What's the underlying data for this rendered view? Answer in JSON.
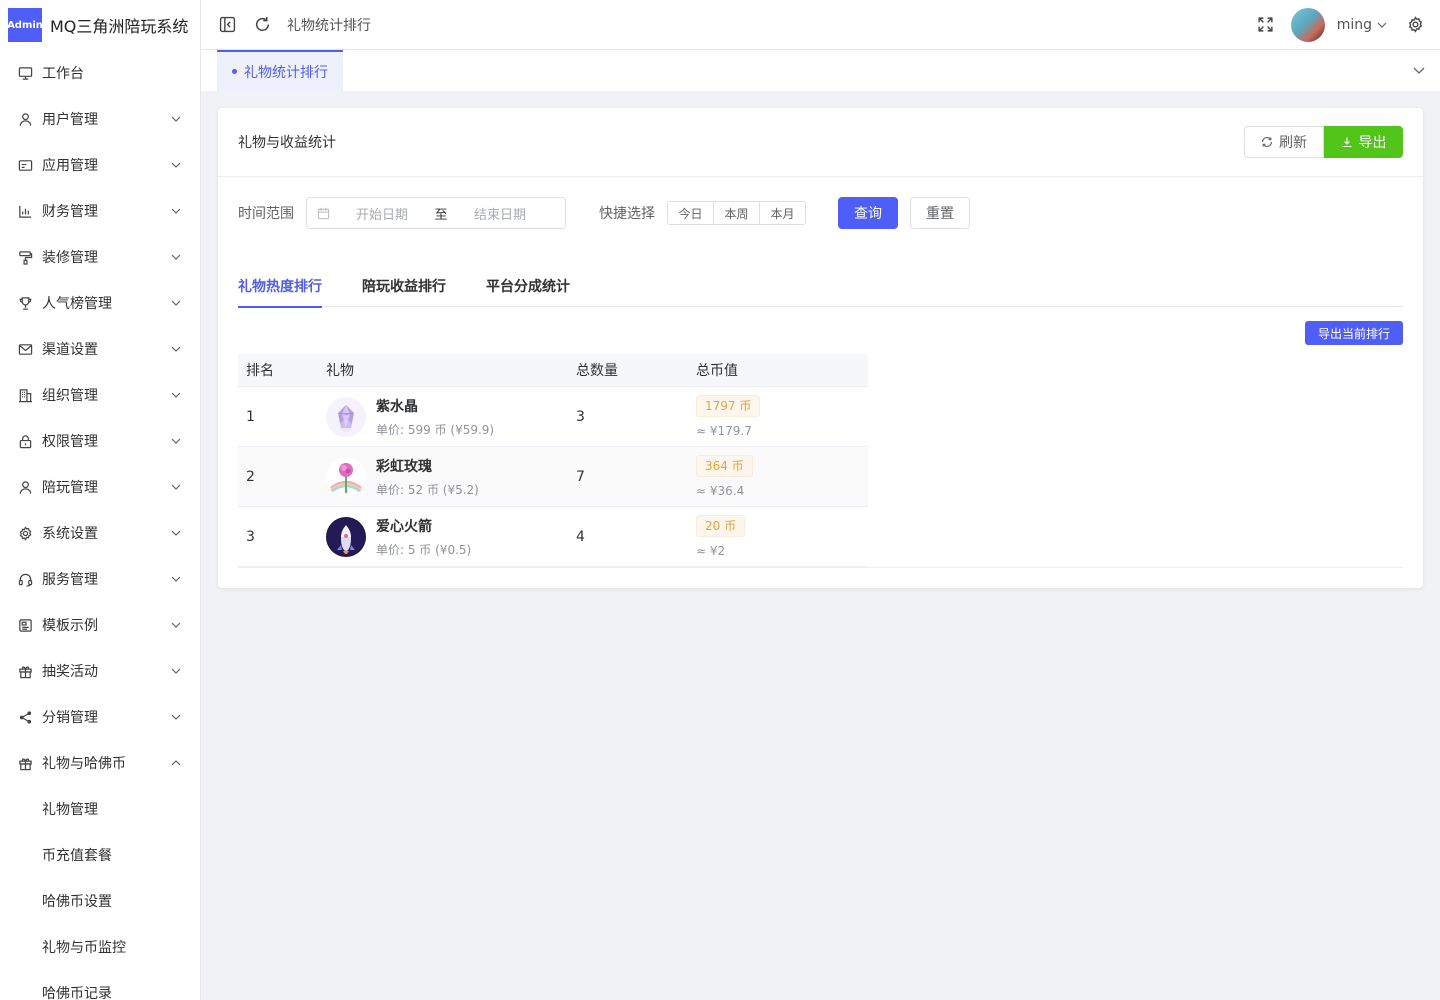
{
  "app": {
    "badge": "Admin",
    "title": "MQ三角洲陪玩系统"
  },
  "sidebar": {
    "items": [
      {
        "label": "工作台",
        "icon": "monitor-icon",
        "has_arrow": false
      },
      {
        "label": "用户管理",
        "icon": "user-icon",
        "has_arrow": true
      },
      {
        "label": "应用管理",
        "icon": "app-window-icon",
        "has_arrow": true
      },
      {
        "label": "财务管理",
        "icon": "bar-chart-icon",
        "has_arrow": true
      },
      {
        "label": "装修管理",
        "icon": "paint-roller-icon",
        "has_arrow": true
      },
      {
        "label": "人气榜管理",
        "icon": "trophy-icon",
        "has_arrow": true
      },
      {
        "label": "渠道设置",
        "icon": "mail-icon",
        "has_arrow": true
      },
      {
        "label": "组织管理",
        "icon": "building-icon",
        "has_arrow": true
      },
      {
        "label": "权限管理",
        "icon": "lock-icon",
        "has_arrow": true
      },
      {
        "label": "陪玩管理",
        "icon": "user-icon",
        "has_arrow": true
      },
      {
        "label": "系统设置",
        "icon": "gear-icon",
        "has_arrow": true
      },
      {
        "label": "服务管理",
        "icon": "headset-icon",
        "has_arrow": true
      },
      {
        "label": "模板示例",
        "icon": "template-icon",
        "has_arrow": true
      },
      {
        "label": "抽奖活动",
        "icon": "gift-icon",
        "has_arrow": true
      },
      {
        "label": "分销管理",
        "icon": "share-icon",
        "has_arrow": true
      },
      {
        "label": "礼物与哈佛币",
        "icon": "gift-icon",
        "has_arrow": true,
        "expanded": true
      }
    ],
    "sub_items": [
      "礼物管理",
      "币充值套餐",
      "哈佛币设置",
      "礼物与币监控",
      "哈佛币记录"
    ]
  },
  "header": {
    "breadcrumb": "礼物统计排行",
    "username": "ming"
  },
  "tabbar": {
    "active_tab": "礼物统计排行"
  },
  "card": {
    "title": "礼物与收益统计",
    "refresh_label": "刷新",
    "export_label": "导出",
    "filter": {
      "time_range_label": "时间范围",
      "start_placeholder": "开始日期",
      "separator": "至",
      "end_placeholder": "结束日期",
      "quick_label": "快捷选择",
      "quick_options": [
        "今日",
        "本周",
        "本月"
      ],
      "query_label": "查询",
      "reset_label": "重置"
    },
    "tabs": [
      {
        "label": "礼物热度排行",
        "active": true
      },
      {
        "label": "陪玩收益排行",
        "active": false
      },
      {
        "label": "平台分成统计",
        "active": false
      }
    ],
    "export_rank_label": "导出当前排行",
    "table": {
      "columns": [
        "排名",
        "礼物",
        "总数量",
        "总币值"
      ],
      "rows": [
        {
          "rank": "1",
          "name": "紫水晶",
          "price": "单价: 599 币 (¥59.9)",
          "qty": "3",
          "coins": "1797 币",
          "approx": "≈ ¥179.7"
        },
        {
          "rank": "2",
          "name": "彩虹玫瑰",
          "price": "单价: 52 币 (¥5.2)",
          "qty": "7",
          "coins": "364 币",
          "approx": "≈ ¥36.4"
        },
        {
          "rank": "3",
          "name": "爱心火箭",
          "price": "单价: 5 币 (¥0.5)",
          "qty": "4",
          "coins": "20 币",
          "approx": "≈ ¥2"
        }
      ]
    }
  },
  "colors": {
    "primary": "#4f5ef7",
    "success": "#52c41a",
    "warning": "#e6a23c"
  }
}
